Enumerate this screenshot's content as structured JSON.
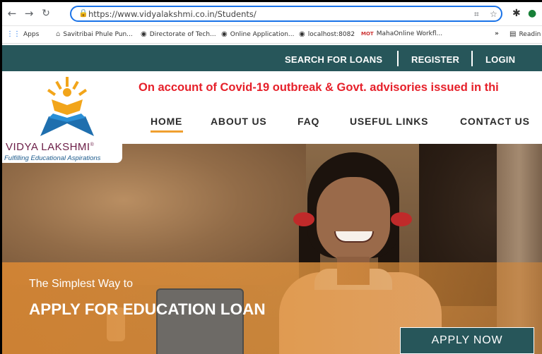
{
  "browser": {
    "url": "https://www.vidyalakshmi.co.in/Students/",
    "nav_icons": [
      "back-icon",
      "forward-icon",
      "reload-icon"
    ],
    "bookmarks": [
      {
        "label": "Apps",
        "icon": "apps-grid-icon"
      },
      {
        "label": "Savitribai Phule Pun...",
        "icon": "university-icon"
      },
      {
        "label": "Directorate of Tech...",
        "icon": "globe-icon"
      },
      {
        "label": "Online Application...",
        "icon": "globe-icon"
      },
      {
        "label": "localhost:8082",
        "icon": "globe-icon"
      },
      {
        "label": "MahaOnline Workfl...",
        "icon": "mahaonline-icon"
      }
    ],
    "more_bookmarks": "»",
    "reading_list": "Readin"
  },
  "site": {
    "top_links": {
      "search": "SEARCH FOR LOANS",
      "register": "REGISTER",
      "login": "LOGIN"
    },
    "logo": {
      "title": "VIDYA LAKSHMI",
      "registered_mark": "®",
      "tagline": "Fulfilling Educational Aspirations"
    },
    "ticker": "On account of Covid-19 outbreak & Govt. advisories issued in thi",
    "nav": [
      {
        "label": "HOME",
        "active": true
      },
      {
        "label": "ABOUT US"
      },
      {
        "label": "FAQ"
      },
      {
        "label": "USEFUL LINKS"
      },
      {
        "label": "CONTACT US"
      }
    ],
    "hero": {
      "subtitle": "The Simplest Way to",
      "title": "APPLY FOR EDUCATION LOAN",
      "cta": "APPLY NOW"
    }
  },
  "colors": {
    "topbar": "#27565a",
    "ticker": "#e6202a",
    "logo_title": "#6b1d46",
    "nav_underline": "#f0a030",
    "hero_band": "#d68634"
  }
}
